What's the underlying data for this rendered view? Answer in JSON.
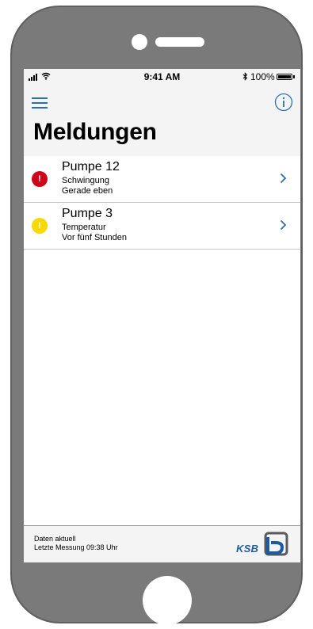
{
  "status_bar": {
    "time": "9:41 AM",
    "battery": "100%"
  },
  "header": {
    "title": "Meldungen",
    "menu_icon": "hamburger-menu-icon",
    "info_icon": "info-icon"
  },
  "alerts": [
    {
      "title": "Pumpe 12",
      "type": "Schwingung",
      "time": "Gerade eben",
      "severity_color": "#d0021b",
      "icon_glyph": "!"
    },
    {
      "title": "Pumpe 3",
      "type": "Temperatur",
      "time": "Vor fünf Stunden",
      "severity_color": "#f8d800",
      "icon_glyph": "!"
    }
  ],
  "footer": {
    "status": "Daten aktuell",
    "last_measurement": "Letzte Messung 09:38 Uhr",
    "logo_text": "KSB"
  },
  "colors": {
    "accent": "#2b6fb3",
    "brand": "#1e5aa0"
  }
}
